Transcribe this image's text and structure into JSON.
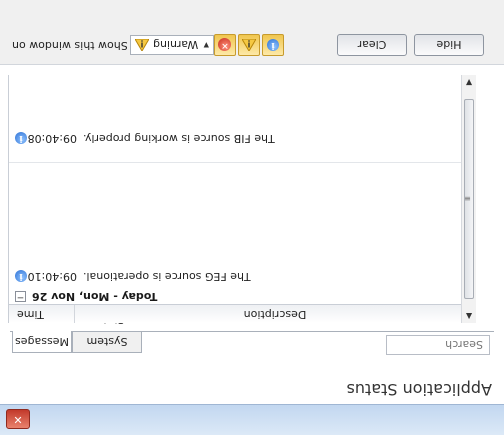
{
  "window": {
    "title": ""
  },
  "app": {
    "title": "Application Status"
  },
  "search": {
    "placeholder": "Search"
  },
  "tabs": [
    {
      "label": "Messages",
      "active": true
    },
    {
      "label": "System Status",
      "active": false
    }
  ],
  "grid": {
    "columns": {
      "time": "Time",
      "description": "Description"
    },
    "group_label": "Today - Mon, Nov 26",
    "rows": [
      {
        "time": "09:40:10",
        "description": "The FEG source is operational.",
        "icon": "info-icon"
      },
      {
        "time": "09:40:08",
        "description": "The FIB source is working properly.",
        "icon": "info-icon"
      }
    ]
  },
  "footer": {
    "show_label": "Show this window on",
    "level_value": "Warning",
    "clear_label": "Clear",
    "hide_label": "Hide"
  },
  "colors": {
    "accent": "#2a6fd3",
    "warning": "#f0c64e",
    "error": "#c62b1c"
  }
}
